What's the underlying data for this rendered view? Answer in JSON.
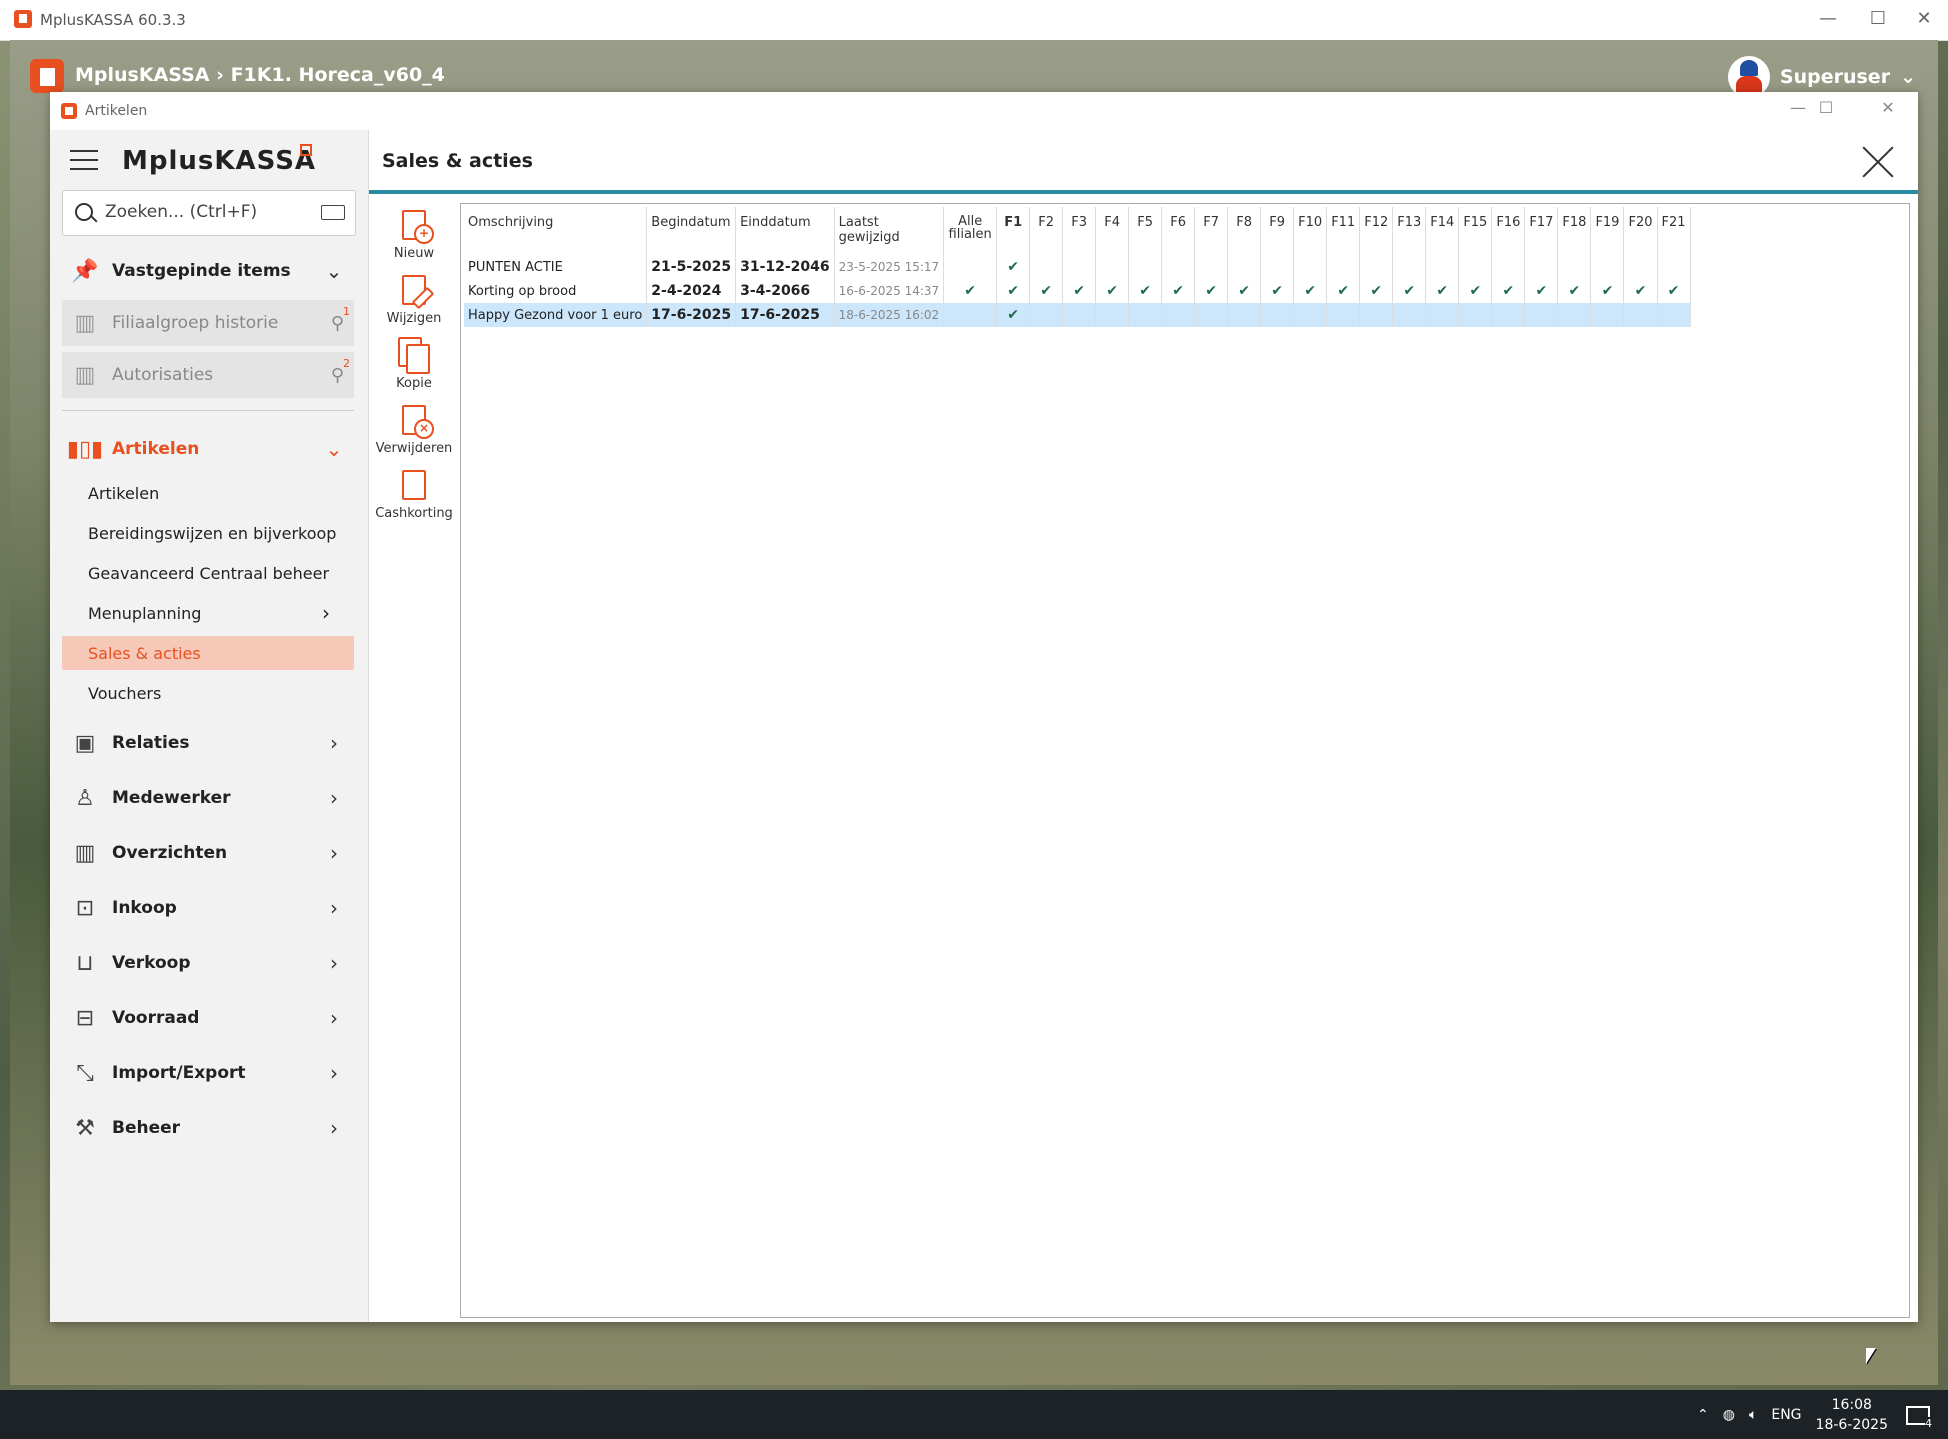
{
  "outer_window": {
    "title": "MplusKASSA 60.3.3"
  },
  "app_header": {
    "path": "MplusKASSA › F1K1. Horeca_v60_4",
    "user": "Superuser"
  },
  "inner_window": {
    "title": "Artikelen"
  },
  "sidebar": {
    "brand": "MplusKASSA",
    "search_placeholder": "Zoeken... (Ctrl+F)",
    "pinned": {
      "label": "Vastgepinde items"
    },
    "disabled_items": [
      {
        "label": "Filiaalgroep historie",
        "badge": "1"
      },
      {
        "label": "Autorisaties",
        "badge": "2"
      }
    ],
    "artikelen": {
      "label": "Artikelen"
    },
    "sub_items": [
      {
        "label": "Artikelen"
      },
      {
        "label": "Bereidingswijzen en bijverkoop"
      },
      {
        "label": "Geavanceerd Centraal beheer"
      },
      {
        "label": "Menuplanning"
      },
      {
        "label": "Sales & acties"
      },
      {
        "label": "Vouchers"
      }
    ],
    "sections": [
      {
        "label": "Relaties",
        "icon": "contacts-icon"
      },
      {
        "label": "Medewerker",
        "icon": "person-icon"
      },
      {
        "label": "Overzichten",
        "icon": "bar-chart-icon"
      },
      {
        "label": "Inkoop",
        "icon": "inbox-icon"
      },
      {
        "label": "Verkoop",
        "icon": "shopping-bag-icon"
      },
      {
        "label": "Voorraad",
        "icon": "archive-box-icon"
      },
      {
        "label": "Import/Export",
        "icon": "import-export-icon"
      },
      {
        "label": "Beheer",
        "icon": "tools-icon"
      }
    ]
  },
  "main": {
    "title": "Sales & acties",
    "toolbar": [
      {
        "label": "Nieuw",
        "icon": "new-document-icon"
      },
      {
        "label": "Wijzigen",
        "icon": "edit-document-icon"
      },
      {
        "label": "Kopie",
        "icon": "copy-document-icon"
      },
      {
        "label": "Verwijderen",
        "icon": "delete-document-icon"
      },
      {
        "label": "Cashkorting",
        "icon": "cash-discount-icon"
      }
    ],
    "table": {
      "headers": [
        "Omschrijving",
        "Begindatum",
        "Einddatum",
        "Laatst gewijzigd",
        "Alle filialen",
        "F1",
        "F2",
        "F3",
        "F4",
        "F5",
        "F6",
        "F7",
        "F8",
        "F9",
        "F10",
        "F11",
        "F12",
        "F13",
        "F14",
        "F15",
        "F16",
        "F17",
        "F18",
        "F19",
        "F20",
        "F21"
      ],
      "rows": [
        {
          "omschrijving": "PUNTEN ACTIE",
          "begindatum": "21-5-2025",
          "einddatum": "31-12-2046",
          "gewijzigd": "23-5-2025 15:17",
          "checks": [
            false,
            true,
            false,
            false,
            false,
            false,
            false,
            false,
            false,
            false,
            false,
            false,
            false,
            false,
            false,
            false,
            false,
            false,
            false,
            false,
            false,
            false
          ]
        },
        {
          "omschrijving": "Korting op brood",
          "begindatum": "2-4-2024",
          "einddatum": "3-4-2066",
          "gewijzigd": "16-6-2025 14:37",
          "checks": [
            true,
            true,
            true,
            true,
            true,
            true,
            true,
            true,
            true,
            true,
            true,
            true,
            true,
            true,
            true,
            true,
            true,
            true,
            true,
            true,
            true,
            true
          ]
        },
        {
          "omschrijving": "Happy Gezond voor 1 euro",
          "begindatum": "17-6-2025",
          "einddatum": "17-6-2025",
          "gewijzigd": "18-6-2025 16:02",
          "checks": [
            false,
            true,
            false,
            false,
            false,
            false,
            false,
            false,
            false,
            false,
            false,
            false,
            false,
            false,
            false,
            false,
            false,
            false,
            false,
            false,
            false,
            false
          ],
          "selected": true
        }
      ]
    }
  },
  "taskbar": {
    "language": "ENG",
    "time": "16:08",
    "date": "18-6-2025",
    "notifications": "4"
  },
  "colors": {
    "accent": "#e8501f",
    "teal": "#2a8ba0",
    "check": "#1e6b47",
    "selected_row": "#cce6fb"
  }
}
